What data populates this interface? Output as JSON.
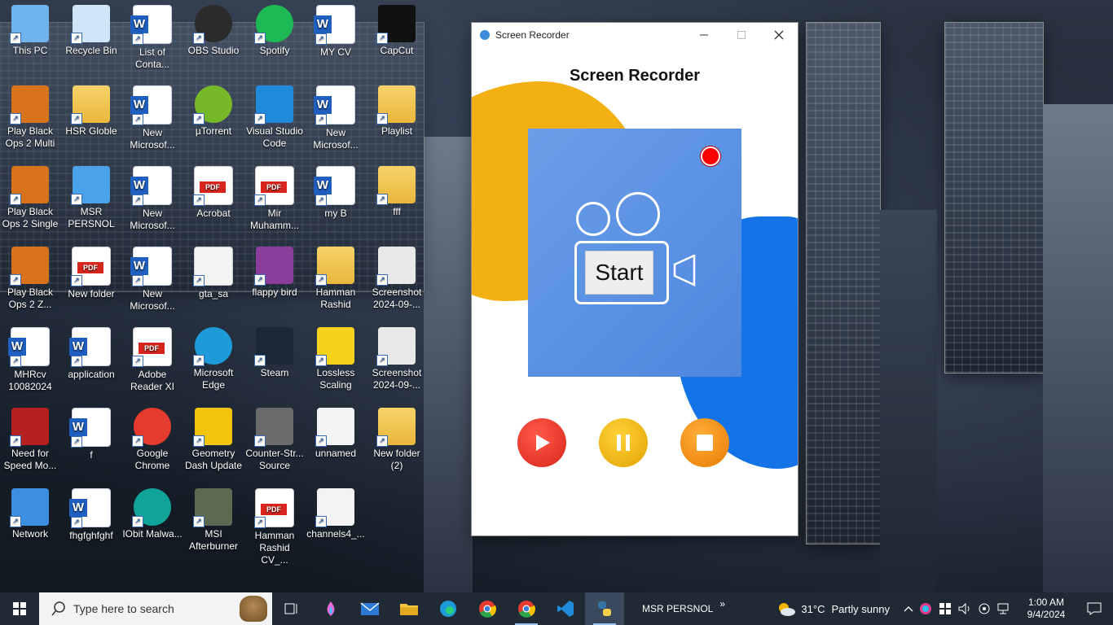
{
  "desktop": {
    "icons": [
      {
        "label": "This PC",
        "icon": "this-pc-icon"
      },
      {
        "label": "Recycle Bin",
        "icon": "recycle-bin-icon"
      },
      {
        "label": "List of Conta...",
        "icon": "word-doc-icon"
      },
      {
        "label": "OBS Studio",
        "icon": "obs-icon"
      },
      {
        "label": "Spotify",
        "icon": "spotify-icon"
      },
      {
        "label": "MY CV",
        "icon": "word-doc-icon"
      },
      {
        "label": "CapCut",
        "icon": "capcut-icon"
      },
      {
        "label": "Play Black Ops 2 Multi",
        "icon": "black-ops-icon"
      },
      {
        "label": "HSR Globle",
        "icon": "folder-user-icon"
      },
      {
        "label": "New Microsof...",
        "icon": "word-doc-icon"
      },
      {
        "label": "µTorrent",
        "icon": "utorrent-icon"
      },
      {
        "label": "Visual Studio Code",
        "icon": "vscode-icon"
      },
      {
        "label": "New Microsof...",
        "icon": "word-doc-icon"
      },
      {
        "label": "Playlist",
        "icon": "folder-python-icon"
      },
      {
        "label": "Play Black Ops 2 Single",
        "icon": "black-ops-icon"
      },
      {
        "label": "MSR PERSNOL",
        "icon": "folder-blue-icon"
      },
      {
        "label": "New Microsof...",
        "icon": "word-doc-icon"
      },
      {
        "label": "Acrobat",
        "icon": "acrobat-icon"
      },
      {
        "label": "Mir Muhamm...",
        "icon": "pdf-icon"
      },
      {
        "label": "my B",
        "icon": "word-doc-icon"
      },
      {
        "label": "fff",
        "icon": "folder-python-icon"
      },
      {
        "label": "Play Black Ops 2 Z...",
        "icon": "black-ops-icon"
      },
      {
        "label": "New folder",
        "icon": "pdf-icon"
      },
      {
        "label": "New Microsof...",
        "icon": "word-doc-icon"
      },
      {
        "label": "gta_sa",
        "icon": "blank-file-icon"
      },
      {
        "label": "flappy bird",
        "icon": "winrar-icon"
      },
      {
        "label": "Hamman Rashid",
        "icon": "folder-icon"
      },
      {
        "label": "Screenshot 2024-09-...",
        "icon": "screenshot-icon"
      },
      {
        "label": "MHRcv 10082024",
        "icon": "word-doc-icon"
      },
      {
        "label": "application",
        "icon": "word-doc-icon"
      },
      {
        "label": "Adobe Reader XI",
        "icon": "acrobat-icon"
      },
      {
        "label": "Microsoft Edge",
        "icon": "edge-icon"
      },
      {
        "label": "Steam",
        "icon": "steam-icon"
      },
      {
        "label": "Lossless Scaling",
        "icon": "duck-icon"
      },
      {
        "label": "Screenshot 2024-09-...",
        "icon": "screenshot-icon"
      },
      {
        "label": "Need for Speed Mo...",
        "icon": "nfs-icon"
      },
      {
        "label": "f",
        "icon": "word-doc-icon"
      },
      {
        "label": "Google Chrome",
        "icon": "chrome-icon"
      },
      {
        "label": "Geometry Dash Update",
        "icon": "geometry-dash-icon"
      },
      {
        "label": "Counter-Str... Source",
        "icon": "counter-strike-icon"
      },
      {
        "label": "unnamed",
        "icon": "image-icon"
      },
      {
        "label": "New folder (2)",
        "icon": "folder-icon"
      },
      {
        "label": "Network",
        "icon": "network-icon"
      },
      {
        "label": "fhgfghfghf",
        "icon": "word-doc-icon"
      },
      {
        "label": "IObit Malwa...",
        "icon": "iobit-icon"
      },
      {
        "label": "MSI Afterburner",
        "icon": "msi-afterburner-icon"
      },
      {
        "label": "Hamman Rashid CV_...",
        "icon": "pdf-icon"
      },
      {
        "label": "channels4_...",
        "icon": "image-icon"
      }
    ]
  },
  "window": {
    "title": "Screen Recorder",
    "heading": "Screen Recorder",
    "start_label": "Start",
    "colors": {
      "accent_yellow": "#f2b012",
      "accent_blue": "#1473e6",
      "stage": "#5b93e3",
      "record": "#ff0000"
    }
  },
  "taskbar": {
    "search_placeholder": "Type here to search",
    "active_app_label": "MSR PERSNOL",
    "overflow": "»",
    "weather_temp": "31°C",
    "weather_text": "Partly sunny",
    "time": "1:00 AM",
    "date": "9/4/2024"
  }
}
